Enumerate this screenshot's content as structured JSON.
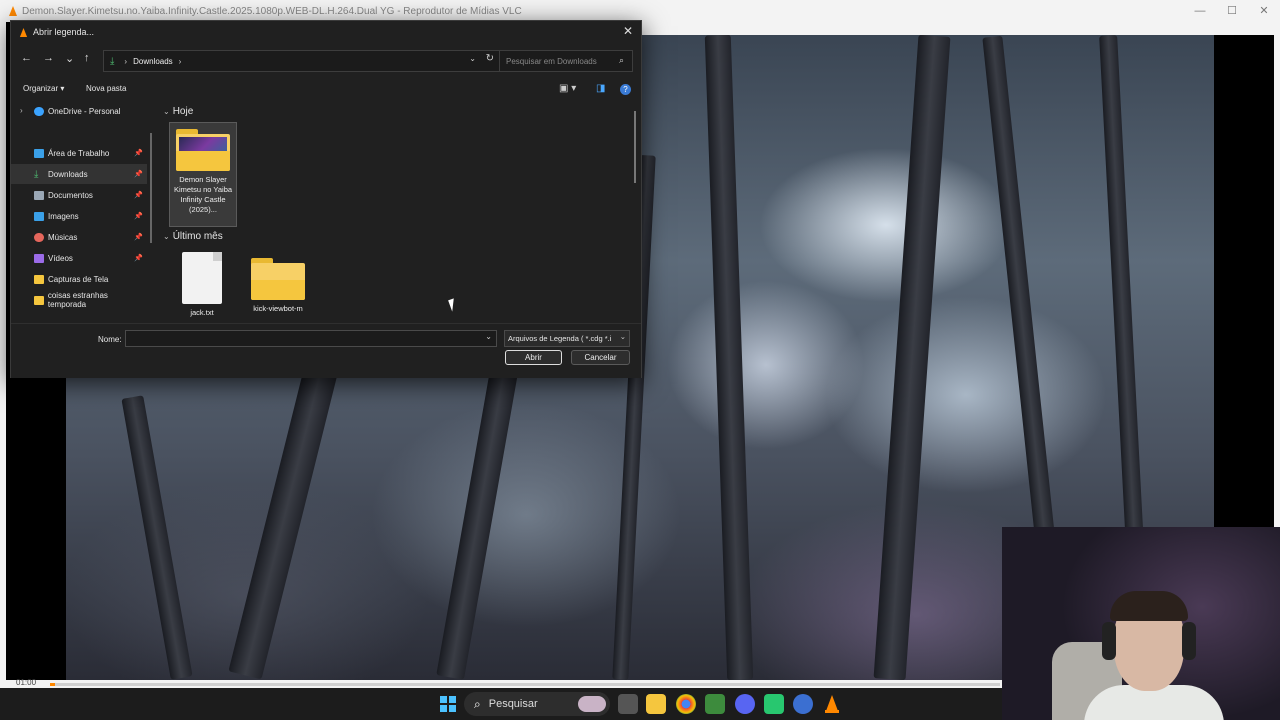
{
  "vlc": {
    "title": "Demon.Slayer.Kimetsu.no.Yaiba.Infinity.Castle.2025.1080p.WEB-DL.H.264.Dual YG - Reprodutor de Mídias VLC",
    "minimize": "—",
    "maximize": "☐",
    "close": "✕",
    "time": "01:00",
    "progress": 0.005,
    "accent": "#ff8800"
  },
  "dialog": {
    "title": "Abrir legenda...",
    "close": "✕",
    "nav": {
      "back": "←",
      "forward": "→",
      "recent": "⌄",
      "up": "↑"
    },
    "address": {
      "crumb_sep": "›",
      "folder": "Downloads",
      "crumb_after": "›"
    },
    "search_placeholder": "Pesquisar em Downloads",
    "toolbar": {
      "organize": "Organizar",
      "organize_arrow": "▾",
      "new_folder": "Nova pasta"
    },
    "sidebar": {
      "items": [
        {
          "label": "OneDrive - Personal",
          "icon": "cloud-icon",
          "color": "#3ba3ff",
          "pinned": false,
          "expander": true
        },
        {
          "label": "Área de Trabalho",
          "icon": "desktop-icon",
          "color": "#3aa0e8",
          "pinned": true
        },
        {
          "label": "Downloads",
          "icon": "download-icon",
          "color": "#4fbf73",
          "pinned": true,
          "active": true
        },
        {
          "label": "Documentos",
          "icon": "document-icon",
          "color": "#9aa7b5",
          "pinned": true
        },
        {
          "label": "Imagens",
          "icon": "image-icon",
          "color": "#3aa0e8",
          "pinned": true
        },
        {
          "label": "Músicas",
          "icon": "music-icon",
          "color": "#e5665c",
          "pinned": true
        },
        {
          "label": "Vídeos",
          "icon": "video-icon",
          "color": "#9b6be8",
          "pinned": true
        },
        {
          "label": "Capturas de Tela",
          "icon": "folder-icon",
          "color": "#f5c63e",
          "pinned": false
        },
        {
          "label": "coisas estranhas temporada",
          "icon": "folder-icon",
          "color": "#f5c63e",
          "pinned": false
        }
      ]
    },
    "groups": [
      {
        "label": "Hoje",
        "files": [
          {
            "name": "Demon Slayer Kimetsu no Yaiba Infinity Castle (2025)...",
            "type": "folder-media"
          }
        ]
      },
      {
        "label": "Último mês",
        "files": [
          {
            "name": "jack.txt",
            "type": "text"
          },
          {
            "name": "kick-viewbot-m",
            "type": "folder"
          }
        ]
      }
    ],
    "name_label": "Nome:",
    "name_value": "",
    "filter": "Arquivos de Legenda ( *.cdg *.i",
    "open_button": "Abrir",
    "cancel_button": "Cancelar"
  },
  "taskbar": {
    "search_label": "Pesquisar"
  }
}
